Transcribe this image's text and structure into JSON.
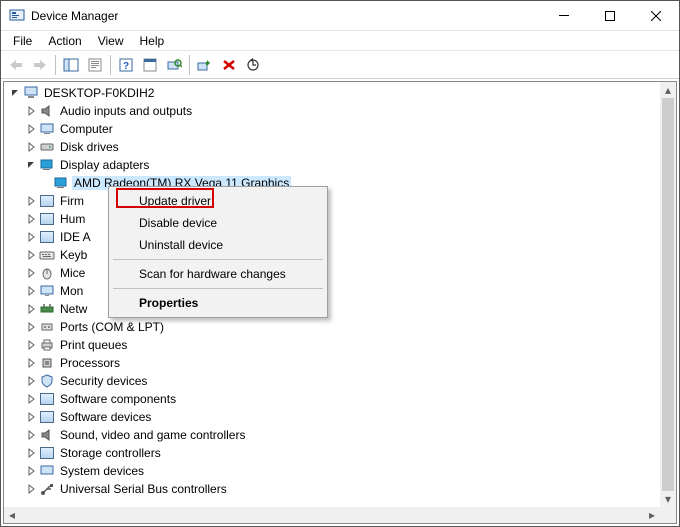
{
  "window": {
    "title": "Device Manager"
  },
  "menu": {
    "file": "File",
    "action": "Action",
    "view": "View",
    "help": "Help"
  },
  "tree": {
    "root": "DESKTOP-F0KDIH2",
    "nodes": [
      "Audio inputs and outputs",
      "Computer",
      "Disk drives",
      "Display adapters",
      "Firmware",
      "Human Interface Devices",
      "IDE ATA/ATAPI controllers",
      "Keyboards",
      "Mice and other pointing devices",
      "Monitors",
      "Network adapters",
      "Ports (COM & LPT)",
      "Print queues",
      "Processors",
      "Security devices",
      "Software components",
      "Software devices",
      "Sound, video and game controllers",
      "Storage controllers",
      "System devices",
      "Universal Serial Bus controllers"
    ],
    "display_child": "AMD Radeon(TM) RX Vega 11 Graphics",
    "truncated": {
      "firm": "Firm",
      "hum": "Hum",
      "ide": "IDE A",
      "keyb": "Keyb",
      "mice": "Mice",
      "mon": "Mon",
      "netw": "Netw"
    }
  },
  "context_menu": {
    "update": "Update driver",
    "disable": "Disable device",
    "uninstall": "Uninstall device",
    "scan": "Scan for hardware changes",
    "properties": "Properties"
  }
}
